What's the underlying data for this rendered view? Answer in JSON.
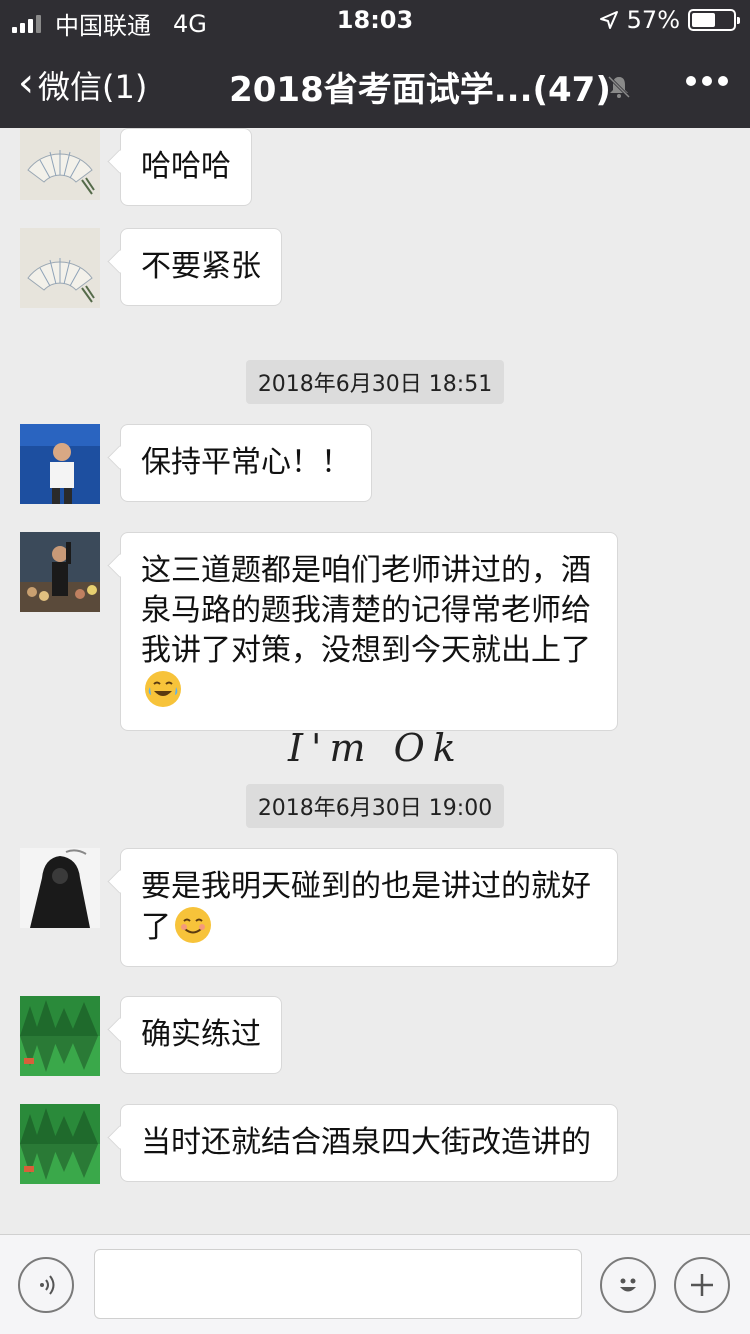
{
  "status_bar": {
    "carrier": "中国联通",
    "network": "4G",
    "time": "18:03",
    "battery": "57%",
    "battery_level": 0.57
  },
  "nav": {
    "back_label": "微信(1)",
    "title": "2018省考面试学...(47)"
  },
  "messages": [
    {
      "avatar": "fan-painting-avatar",
      "text": "哈哈哈"
    },
    {
      "avatar": "fan-painting-avatar",
      "text": "不要紧张"
    },
    {
      "avatar": "speaker-stage-avatar",
      "text": "保持平常心！！"
    },
    {
      "avatar": "crowd-photo-avatar",
      "text": "这三道题都是咱们老师讲过的，酒泉马路的题我清楚的记得常老师给我讲了对策，没想到今天就出上了",
      "emoji": "tears-of-joy-emoji"
    },
    {
      "avatar": "hooded-figure-avatar",
      "text": "要是我明天碰到的也是讲过的就好了",
      "emoji": "smiling-face-emoji"
    },
    {
      "avatar": "green-forest-avatar",
      "text": "确实练过"
    },
    {
      "avatar": "green-forest-avatar",
      "text": "当时还就结合酒泉四大街改造讲的"
    }
  ],
  "timestamps": [
    "2018年6月30日 18:51",
    "2018年6月30日 19:00"
  ],
  "watermark_text": "I'm Ok",
  "colors": {
    "nav_bg": "#2f2e33",
    "chat_bg": "#ececec",
    "bubble_bg": "#ffffff",
    "timestamp_bg": "#dcdcdc"
  }
}
